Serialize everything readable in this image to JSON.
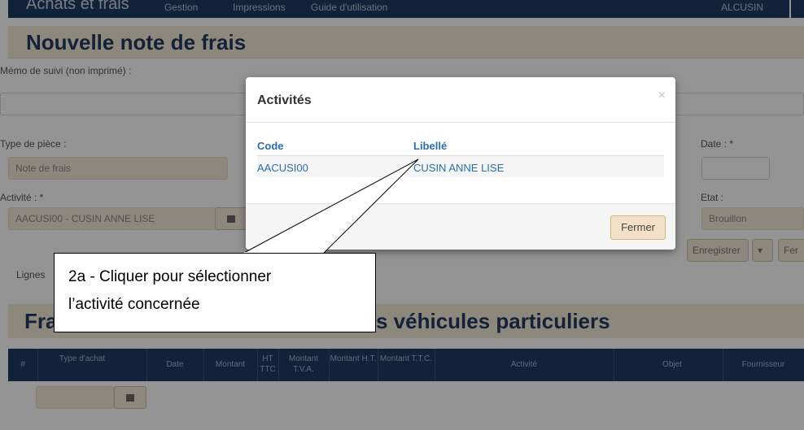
{
  "topnav": {
    "brand": "Achats et frais",
    "menu": [
      "Gestion",
      "Impressions",
      "Guide d'utilisation"
    ],
    "user": "ALCUSIN"
  },
  "page": {
    "title": "Nouvelle note de frais",
    "memo_label": "Mémo de suivi (non imprimé) :",
    "type_label": "Type de pièce :",
    "type_value": "Note de frais",
    "activity_label": "Activité : *",
    "activity_value": "AACUSI00 - CUSIN ANNE LISE",
    "date_label": "Date : *",
    "state_label": "Etat :",
    "state_value": "Brouillon",
    "save_label": "Enregistrer",
    "close_partial": "Fer",
    "lines_label": "Lignes",
    "section_title_start": "Fra",
    "section_title_end": "s véhicules particuliers",
    "table_headers": [
      "#",
      "Type d'achat",
      "Date",
      "Montant",
      "HT TTC",
      "Montant T.V.A.",
      "Montant H.T.",
      "Montant T.T.C.",
      "Activité",
      "Objet",
      "Fournisseur"
    ]
  },
  "modal": {
    "title": "Activités",
    "close_glyph": "×",
    "columns": [
      "Code",
      "Libellé"
    ],
    "rows": [
      {
        "code": "AACUSI00",
        "libelle": "CUSIN ANNE LISE"
      }
    ],
    "close_button": "Fermer"
  },
  "annotation": {
    "line1": "2a - Cliquer pour sélectionner",
    "line2": "l’activité concernée"
  }
}
